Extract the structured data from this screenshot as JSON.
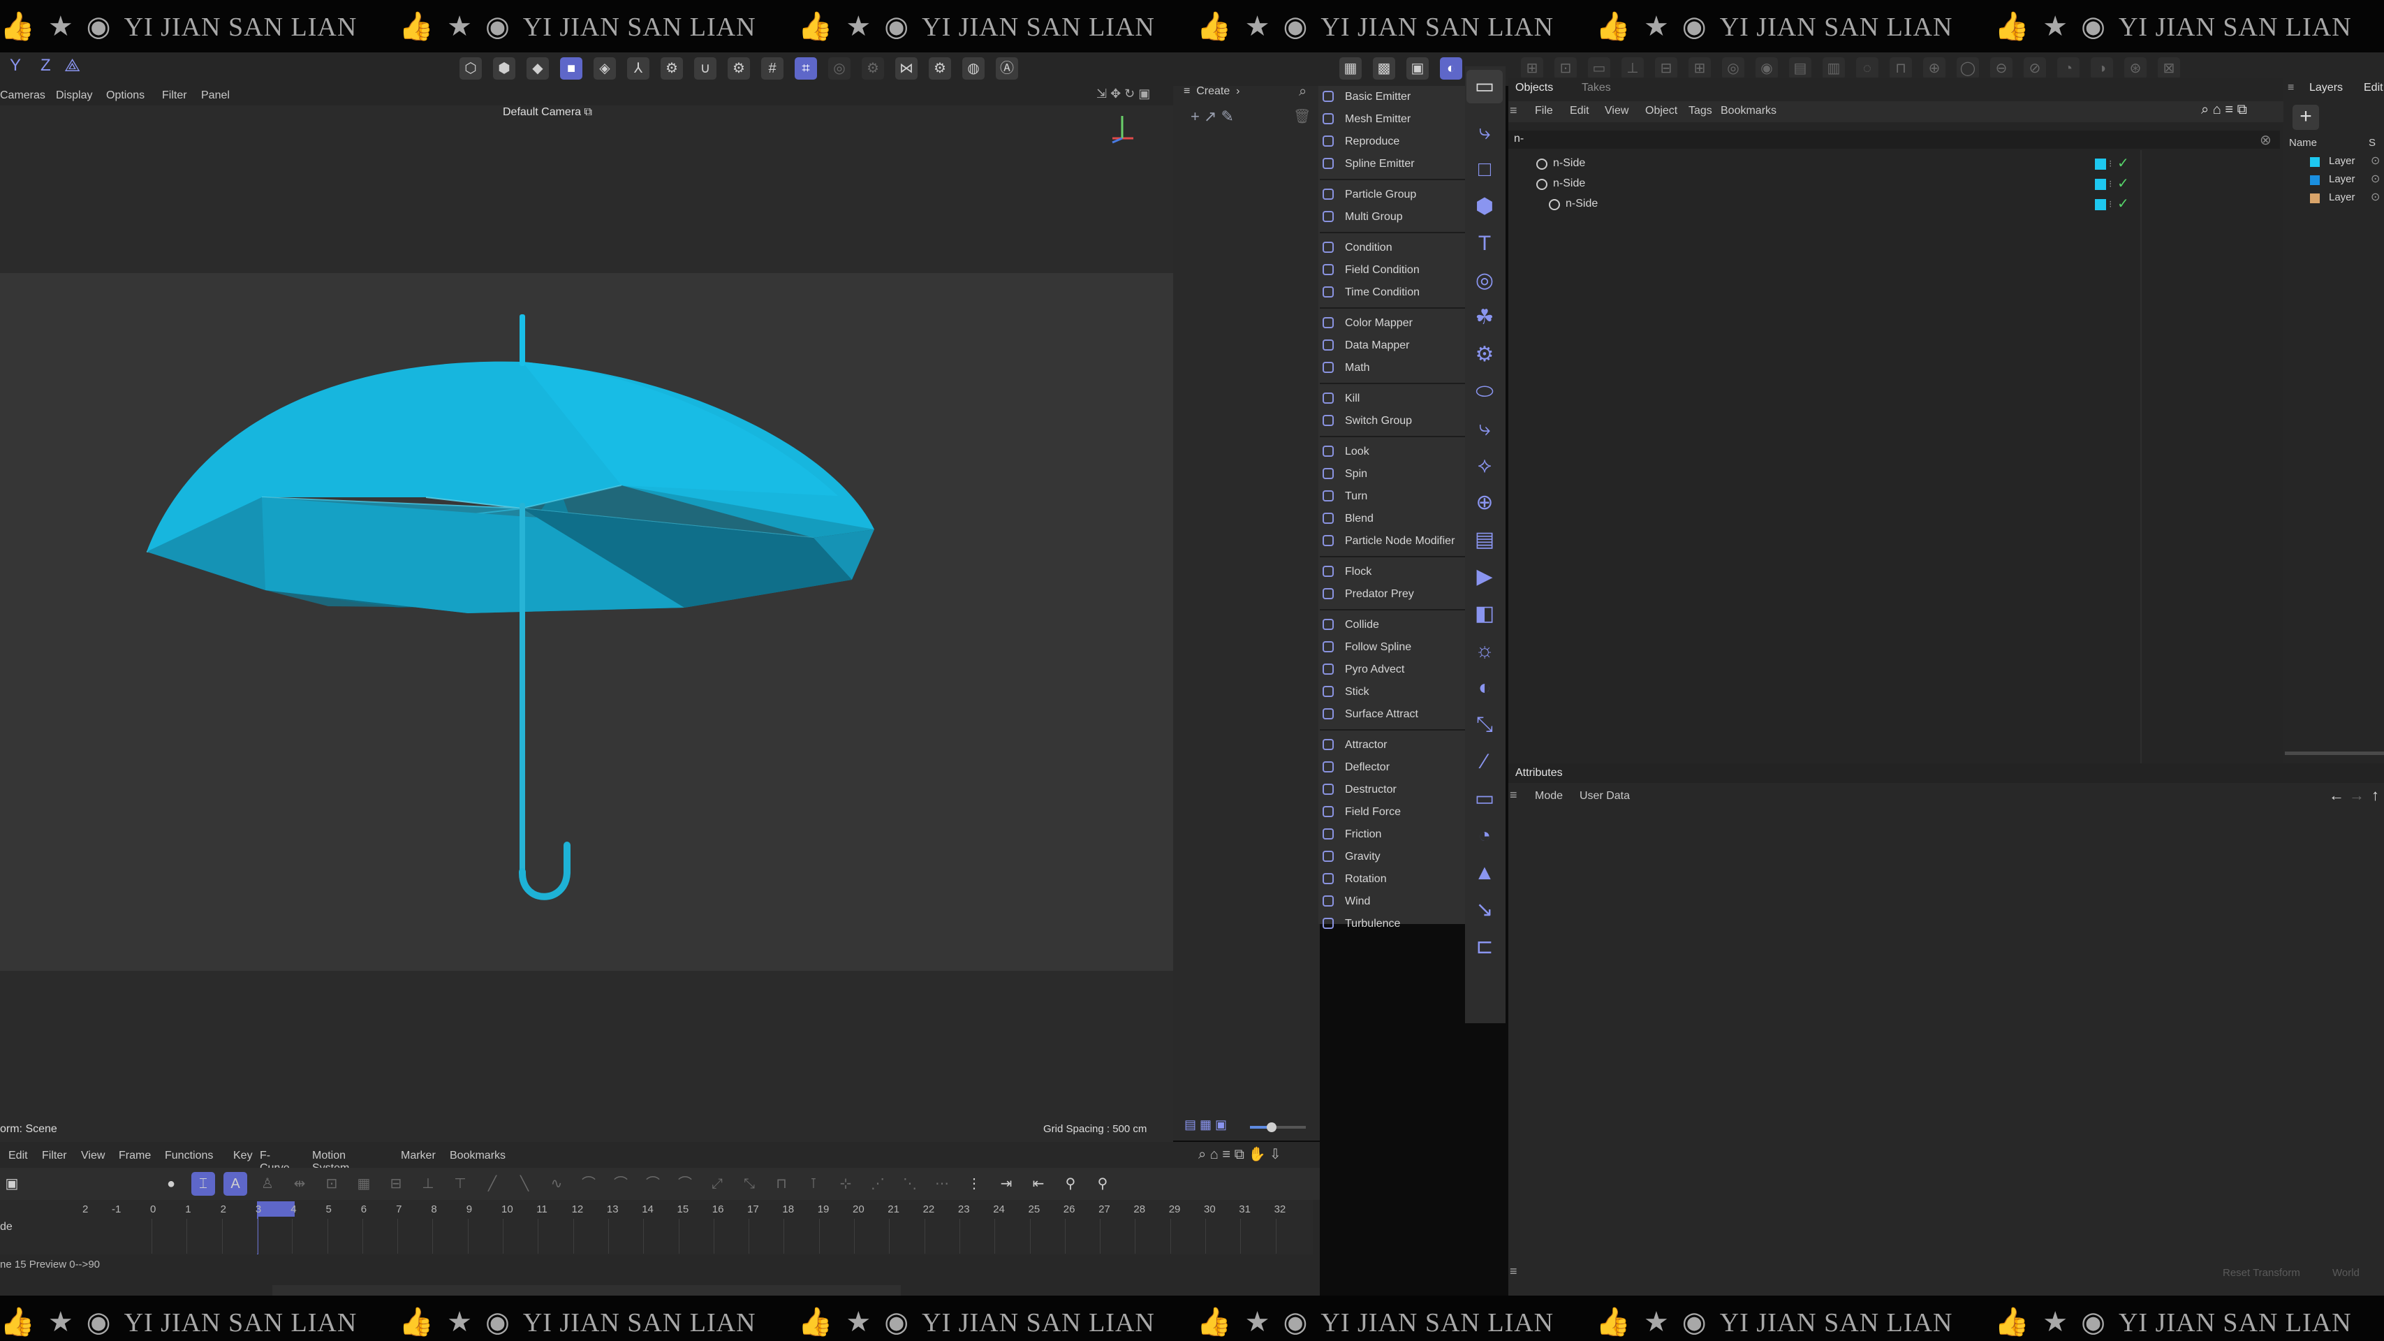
{
  "watermark": {
    "text": "YI JIAN SAN LIAN",
    "repeat": 6
  },
  "viewport": {
    "menu": [
      "Cameras",
      "Display",
      "Options",
      "Filter",
      "Panel"
    ],
    "camera_label": "Default Camera",
    "grid_spacing": "Grid Spacing : 500 cm",
    "status": "orm: Scene",
    "axis_labels": [
      "Y",
      "Z"
    ]
  },
  "create_menu": {
    "header": "Create",
    "groups": [
      [
        "Basic Emitter",
        "Mesh Emitter",
        "Reproduce",
        "Spline Emitter"
      ],
      [
        "Particle Group",
        "Multi Group"
      ],
      [
        "Condition",
        "Field Condition",
        "Time Condition"
      ],
      [
        "Color Mapper",
        "Data Mapper",
        "Math"
      ],
      [
        "Kill",
        "Switch Group"
      ],
      [
        "Look",
        "Spin",
        "Turn",
        "Blend",
        "Particle Node Modifier"
      ],
      [
        "Flock",
        "Predator Prey"
      ],
      [
        "Collide",
        "Follow Spline",
        "Pyro Advect",
        "Stick",
        "Surface Attract"
      ],
      [
        "Attractor",
        "Deflector",
        "Destructor",
        "Field Force",
        "Friction",
        "Gravity",
        "Rotation",
        "Wind",
        "Turbulence"
      ]
    ]
  },
  "objects_panel": {
    "tabs": [
      "Objects",
      "Takes"
    ],
    "menu": [
      "File",
      "Edit",
      "View",
      "Object",
      "Tags",
      "Bookmarks"
    ],
    "search_value": "n-",
    "rows": [
      {
        "name": "n-Side",
        "color": "#1ec8f0"
      },
      {
        "name": "n-Side",
        "color": "#1ec8f0"
      },
      {
        "name": "n-Side",
        "color": "#1ec8f0"
      }
    ]
  },
  "layers_panel": {
    "tabs": [
      "Layers",
      "Edit"
    ],
    "column_headers": [
      "Name",
      "S"
    ],
    "rows": [
      {
        "name": "Layer",
        "color": "#1ec8f0"
      },
      {
        "name": "Layer",
        "color": "#1a8fe0"
      },
      {
        "name": "Layer",
        "color": "#d9a46a"
      }
    ]
  },
  "attributes_panel": {
    "tab": "Attributes",
    "menu": [
      "Mode",
      "User Data"
    ],
    "footer": [
      "Reset Transform",
      "World"
    ]
  },
  "timeline": {
    "menu": [
      "Edit",
      "Filter",
      "View",
      "Frame",
      "Functions",
      "Key",
      "F-Curve",
      "Motion System",
      "Marker",
      "Bookmarks"
    ],
    "left_label": "de",
    "ruler_prefix": [
      "2",
      "-1"
    ],
    "ruler_numbers": [
      "0",
      "1",
      "2",
      "3",
      "4",
      "5",
      "6",
      "7",
      "8",
      "9",
      "10",
      "11",
      "12",
      "13",
      "14",
      "15",
      "16",
      "17",
      "18",
      "19",
      "20",
      "21",
      "22",
      "23",
      "24",
      "25",
      "26",
      "27",
      "28",
      "29",
      "30",
      "31",
      "32"
    ],
    "current_frame": "3",
    "status": "ne 15 Preview 0-->90"
  },
  "colors": {
    "accent": "#5e67c9",
    "umbrella": "#14b8e0",
    "panel_bg": "#2b2b2b",
    "viewport_bg": "#333333"
  }
}
